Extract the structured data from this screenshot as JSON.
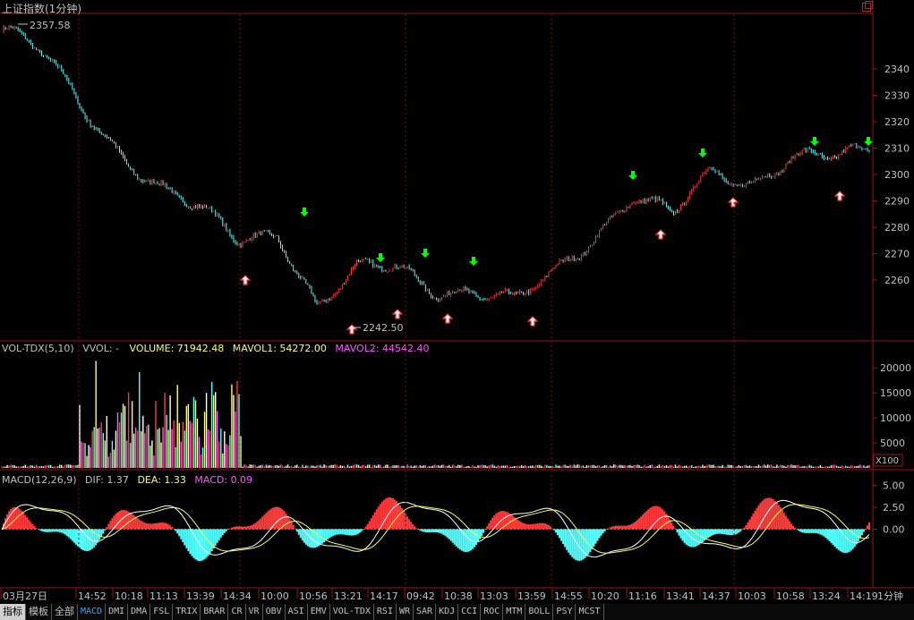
{
  "window": {
    "title": "上证指数(1分钟)"
  },
  "price_panel": {
    "high_label": "2357.58",
    "low_label": "2242.50",
    "y_ticks": [
      "2340",
      "2330",
      "2320",
      "2310",
      "2300",
      "2290",
      "2280",
      "2270",
      "2260"
    ]
  },
  "vol_panel": {
    "name": "VOL-TDX(5,10)",
    "vvol": "VVOL: -",
    "volume": "VOLUME: 71942.48",
    "mavol1": "MAVOL1: 54272.00",
    "mavol2": "MAVOL2: 44542.40",
    "y_ticks": [
      "20000",
      "15000",
      "10000",
      "5000"
    ],
    "unit": "X100"
  },
  "macd_panel": {
    "name": "MACD(12,26,9)",
    "dif": "DIF: 1.37",
    "dea": "DEA: 1.33",
    "macd": "MACD: 0.09",
    "y_ticks": [
      "5.00",
      "2.50",
      "0.00"
    ]
  },
  "x_axis": {
    "ticks": [
      "03月27日",
      "14:52",
      "10:18",
      "11:13",
      "13:39",
      "14:34",
      "10:00",
      "10:56",
      "13:21",
      "14:17",
      "09:42",
      "10:38",
      "13:03",
      "13:59",
      "14:55",
      "10:20",
      "11:16",
      "13:41",
      "14:37",
      "10:03",
      "10:58",
      "13:24",
      "14:19"
    ]
  },
  "period_label": "1分钟",
  "tabs": [
    "指标",
    "模板",
    "全部",
    "MACD",
    "DMI",
    "DMA",
    "FSL",
    "TRIX",
    "BRAR",
    "CR",
    "VR",
    "OBV",
    "ASI",
    "EMV",
    "VOL-TDX",
    "RSI",
    "WR",
    "SAR",
    "KDJ",
    "CCI",
    "ROC",
    "MTM",
    "BOLL",
    "PSY",
    "MCST"
  ],
  "active_tab": "MACD",
  "colors": {
    "up": "#ff3b3b",
    "down": "#54ffff",
    "label": "#c0c0c0",
    "yellow": "#ffff54",
    "magenta": "#ff54ff",
    "green_arrow": "#00ff00",
    "red_arrow": "#ff3030",
    "frame": "#a01010"
  },
  "chart_data": [
    {
      "type": "line",
      "title": "上证指数(1分钟)",
      "x": [
        "03月27日",
        "14:52",
        "10:18",
        "11:13",
        "13:39",
        "14:34",
        "10:00",
        "10:56",
        "13:21",
        "14:17",
        "09:42",
        "10:38",
        "13:03",
        "13:59",
        "14:55",
        "10:20",
        "11:16",
        "13:41",
        "14:37",
        "10:03",
        "10:58",
        "13:24",
        "14:19"
      ],
      "series": [
        {
          "name": "",
          "values": [
            2355,
            2345,
            2326,
            2310,
            2295,
            2285,
            2275,
            2280,
            2250,
            2262,
            2265,
            2258,
            2256,
            2250,
            2262,
            2278,
            2293,
            2283,
            2300,
            2298,
            2308,
            2305,
            2307
          ]
        }
      ],
      "ylim": [
        2238,
        2360
      ],
      "annotations": {
        "high": "2357.58",
        "low": "2242.50"
      }
    },
    {
      "type": "bar",
      "title": "VOL-TDX(5,10)",
      "y_ticks": [
        5000,
        10000,
        15000,
        20000
      ],
      "ylim": [
        0,
        22000
      ],
      "values_summary": {
        "VOLUME": 71942.48,
        "MAVOL1": 54272.0,
        "MAVOL2": 44542.4
      },
      "unit": "X100"
    },
    {
      "type": "bar",
      "title": "MACD(12,26,9)",
      "series": [
        {
          "name": "DIF",
          "last": 1.37
        },
        {
          "name": "DEA",
          "last": 1.33
        },
        {
          "name": "MACD",
          "last": 0.09
        }
      ],
      "ylim": [
        -6.5,
        6.5
      ],
      "y_ticks": [
        5.0,
        2.5,
        0.0
      ]
    }
  ]
}
